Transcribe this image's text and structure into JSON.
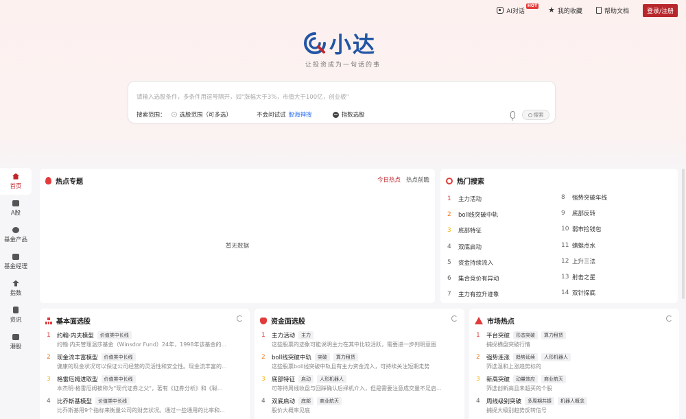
{
  "topnav": {
    "ai_label": "AI对话",
    "hot_badge": "HOT",
    "favorites_label": "我的收藏",
    "help_label": "帮助文档",
    "login_label": "登录/注册"
  },
  "brand": {
    "name": "小达",
    "slogan": "让投资成为一句话的事"
  },
  "search": {
    "placeholder": "请输入选股条件，多条件用逗号隔开，如\"涨幅大于3%，市值大于100亿，创业板\"",
    "scope_label": "搜索范围：",
    "scope_value": "选股范围（可多选）",
    "try_label": "不会问试试",
    "try_link": "股海神搜",
    "index_label": "指数选股",
    "button_label": "搜索"
  },
  "sidebar": {
    "items": [
      {
        "label": "首页",
        "icon": "home-icon"
      },
      {
        "label": "A股",
        "icon": "chart-icon"
      },
      {
        "label": "基金产品",
        "icon": "fund-icon"
      },
      {
        "label": "基金经理",
        "icon": "manager-icon"
      },
      {
        "label": "指数",
        "icon": "index-icon"
      },
      {
        "label": "资讯",
        "icon": "news-icon"
      },
      {
        "label": "港股",
        "icon": "hk-icon"
      }
    ]
  },
  "hot_topics": {
    "title": "热点专题",
    "tabs": [
      "今日热点",
      "热点前瞻"
    ],
    "empty": "暂无数据"
  },
  "hot_search": {
    "title": "热门搜索",
    "left": [
      {
        "num": "1",
        "label": "主力活动"
      },
      {
        "num": "2",
        "label": "boll线突破中轨"
      },
      {
        "num": "3",
        "label": "底部特征"
      },
      {
        "num": "4",
        "label": "双底启动"
      },
      {
        "num": "5",
        "label": "资金持续流入"
      },
      {
        "num": "6",
        "label": "集合竞价有异动"
      },
      {
        "num": "7",
        "label": "主力有拉升迹象"
      }
    ],
    "right": [
      {
        "num": "8",
        "label": "强势突破年线"
      },
      {
        "num": "9",
        "label": "底部反转"
      },
      {
        "num": "10",
        "label": "弱市捡钱包"
      },
      {
        "num": "11",
        "label": "蜻蜓点水"
      },
      {
        "num": "12",
        "label": "上升三法"
      },
      {
        "num": "13",
        "label": "射击之星"
      },
      {
        "num": "14",
        "label": "双针探底"
      }
    ]
  },
  "basic": {
    "title": "基本面选股",
    "items": [
      {
        "num": "1",
        "name": "约翰·内夫模型",
        "tags": [
          "价值类中长线"
        ],
        "desc": "约翰·内夫管理温莎基金（Winsdor Fund）24年，1998年该基金的..."
      },
      {
        "num": "2",
        "name": "现金流丰富模型",
        "tags": [
          "价值类中长线"
        ],
        "desc": "健康的现金状况可以保证公司经营的灵活性和安全性。现金流丰富的..."
      },
      {
        "num": "3",
        "name": "格雷厄姆进取型",
        "tags": [
          "价值类中长线"
        ],
        "desc": "本杰明·格雷厄姆被称为\"现代证券之父\"，著有《证券分析》和《聪..."
      },
      {
        "num": "4",
        "name": "比乔斯基模型",
        "tags": [
          "价值类中长线"
        ],
        "desc": "比乔斯基用9个指标来衡量公司的财务状况。通过一些通用的比率和..."
      }
    ]
  },
  "fund": {
    "title": "资金面选股",
    "items": [
      {
        "num": "1",
        "name": "主力活动",
        "tags": [
          "主力"
        ],
        "desc": "这些股票的迹象可能说明主力在其中比较活跃，需要进一步判明意图"
      },
      {
        "num": "2",
        "name": "boll线突破中轨",
        "tags": [
          "突破",
          "算力租赁"
        ],
        "desc": "这些股票boll线突破中轨且有主力资金流入，可持续关注短期走势"
      },
      {
        "num": "3",
        "name": "底部特征",
        "tags": [
          "启动",
          "人形机器人"
        ],
        "desc": "可等待周线收盘与回踩确认后择机介入，但是需要注意成交量不足启..."
      },
      {
        "num": "4",
        "name": "双底启动",
        "tags": [
          "底部",
          "商业航天"
        ],
        "desc": "股价大概率见底"
      }
    ]
  },
  "market": {
    "title": "市场热点",
    "items": [
      {
        "num": "1",
        "name": "平台突破",
        "tags": [
          "形态突破",
          "算力租赁"
        ],
        "desc": "捕捉横盘突破行情"
      },
      {
        "num": "2",
        "name": "强势连涨",
        "tags": [
          "趋势延续",
          "人形机器人"
        ],
        "desc": "筛选温和上涨趋势标的"
      },
      {
        "num": "3",
        "name": "新高突破",
        "tags": [
          "动量效应",
          "商业航天"
        ],
        "desc": "筛选创新高且未超买的个股"
      },
      {
        "num": "4",
        "name": "周线级别突破",
        "tags": [
          "多周期共振",
          "机器人概念"
        ],
        "desc": "捕捉大级别趋势反转信号"
      }
    ]
  },
  "colors": {
    "accent": "#c0272d",
    "rank1": "#e23b3b",
    "rank2": "#f07a22",
    "rank3": "#f3b416",
    "link": "#2b6ff2",
    "brand": "#2255a4"
  }
}
